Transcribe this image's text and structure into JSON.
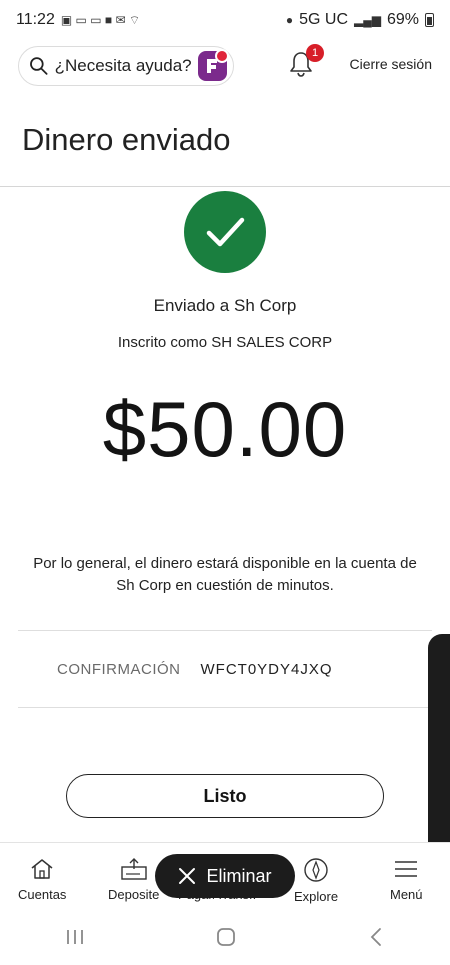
{
  "status_bar": {
    "time": "11:22",
    "network": "5G UC",
    "battery": "69%"
  },
  "header": {
    "search_placeholder": "¿Necesita ayuda?",
    "notification_count": "1",
    "logout_label": "Cierre sesión"
  },
  "page": {
    "title": "Dinero enviado",
    "sent_to": "Enviado a Sh Corp",
    "enrolled_as": "Inscrito como SH SALES CORP",
    "amount": "$50.00",
    "notice": "Por lo general, el dinero estará disponible en la cuenta de Sh Corp en cuestión de minutos.",
    "confirmation_label": "CONFIRMACIÓN",
    "confirmation_value": "WFCT0YDY4JXQ",
    "done_button": "Listo"
  },
  "bottom_nav": {
    "items": [
      {
        "label": "Cuentas",
        "icon": "house-icon"
      },
      {
        "label": "Deposite",
        "icon": "deposit-icon"
      },
      {
        "label": "Pagar/Transf.",
        "icon": "transfer-icon"
      },
      {
        "label": "Explore",
        "icon": "compass-icon"
      },
      {
        "label": "Menú",
        "icon": "menu-icon"
      }
    ]
  },
  "toast": {
    "label": "Eliminar"
  },
  "colors": {
    "success_green": "#1a7f3f",
    "badge_red": "#d71e28",
    "fargo_purple": "#7b2a8c"
  }
}
